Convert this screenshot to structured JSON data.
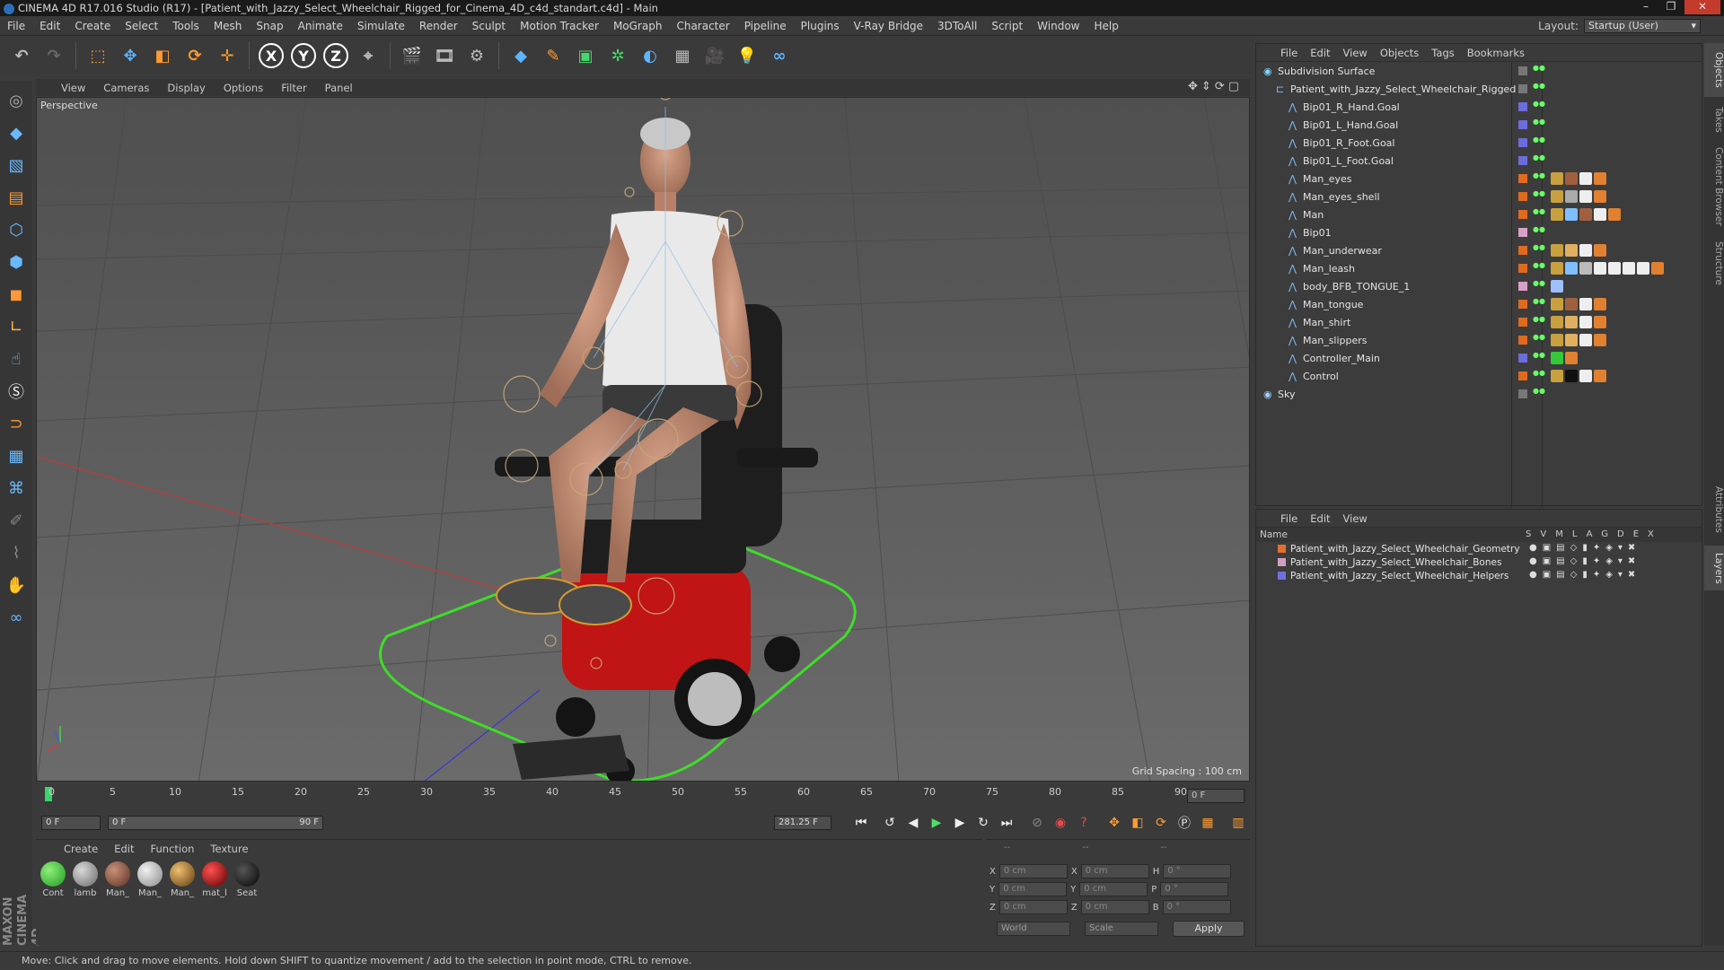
{
  "window": {
    "title": "CINEMA 4D R17.016 Studio (R17) - [Patient_with_Jazzy_Select_Wheelchair_Rigged_for_Cinema_4D_c4d_standart.c4d] - Main"
  },
  "menubar": {
    "items": [
      "File",
      "Edit",
      "Create",
      "Select",
      "Tools",
      "Mesh",
      "Snap",
      "Animate",
      "Simulate",
      "Render",
      "Sculpt",
      "Motion Tracker",
      "MoGraph",
      "Character",
      "Pipeline",
      "Plugins",
      "V-Ray Bridge",
      "3DToAll",
      "Script",
      "Window",
      "Help"
    ],
    "layout_label": "Layout:",
    "layout_value": "Startup (User)"
  },
  "viewport": {
    "menu": [
      "View",
      "Cameras",
      "Display",
      "Options",
      "Filter",
      "Panel"
    ],
    "camera": "Perspective",
    "grid_spacing": "Grid Spacing : 100 cm"
  },
  "timeline": {
    "ticks": [
      "0",
      "5",
      "10",
      "15",
      "20",
      "25",
      "30",
      "35",
      "40",
      "45",
      "50",
      "55",
      "60",
      "65",
      "70",
      "75",
      "80",
      "85",
      "90"
    ],
    "current_frame": "0 F",
    "start_field": "0 F",
    "range_start": "0 F",
    "range_end": "90 F",
    "fps_field": "281.25 F"
  },
  "materials": {
    "menu": [
      "Create",
      "Edit",
      "Function",
      "Texture"
    ],
    "items": [
      {
        "name": "Cont",
        "color": "#35c93a"
      },
      {
        "name": "lamb",
        "color": "#9a9a9a"
      },
      {
        "name": "Man_",
        "color": "#8a5a46"
      },
      {
        "name": "Man_",
        "color": "#b8b8b8"
      },
      {
        "name": "Man_",
        "color": "#c87a2a"
      },
      {
        "name": "mat_l",
        "color": "#b3141c"
      },
      {
        "name": "Seat",
        "color": "#1a1a1a"
      }
    ]
  },
  "coords": {
    "header": [
      "--",
      "--",
      "--"
    ],
    "rows": [
      {
        "a": "X",
        "av": "0 cm",
        "b": "X",
        "bv": "0 cm",
        "c": "H",
        "cv": "0 °"
      },
      {
        "a": "Y",
        "av": "0 cm",
        "b": "Y",
        "bv": "0 cm",
        "c": "P",
        "cv": "0 °"
      },
      {
        "a": "Z",
        "av": "0 cm",
        "b": "Z",
        "bv": "0 cm",
        "c": "B",
        "cv": "0 °"
      }
    ],
    "space": "World",
    "mode": "Scale",
    "apply": "Apply"
  },
  "objects": {
    "menu": [
      "File",
      "Edit",
      "View",
      "Objects",
      "Tags",
      "Bookmarks"
    ],
    "rows": [
      {
        "name": "Subdivision Surface",
        "depth": 0,
        "swatch": "#777777",
        "color": "#7fd7ff"
      },
      {
        "name": "Patient_with_Jazzy_Select_Wheelchair_Rigged",
        "depth": 1,
        "swatch": "#777777",
        "color": "#7fbfff"
      },
      {
        "name": "Bip01_R_Hand.Goal",
        "depth": 2,
        "swatch": "#6c6cdc",
        "color": "#7fbfff"
      },
      {
        "name": "Bip01_L_Hand.Goal",
        "depth": 2,
        "swatch": "#6c6cdc",
        "color": "#7fbfff"
      },
      {
        "name": "Bip01_R_Foot.Goal",
        "depth": 2,
        "swatch": "#6c6cdc",
        "color": "#7fbfff"
      },
      {
        "name": "Bip01_L_Foot.Goal",
        "depth": 2,
        "swatch": "#6c6cdc",
        "color": "#7fbfff"
      },
      {
        "name": "Man_eyes",
        "depth": 2,
        "swatch": "#e06a1e",
        "color": "#7fbfff"
      },
      {
        "name": "Man_eyes_shell",
        "depth": 2,
        "swatch": "#e06a1e",
        "color": "#7fbfff"
      },
      {
        "name": "Man",
        "depth": 2,
        "swatch": "#e06a1e",
        "color": "#7fbfff"
      },
      {
        "name": "Bip01",
        "depth": 2,
        "swatch": "#d8a0c8",
        "color": "#7fbfff"
      },
      {
        "name": "Man_underwear",
        "depth": 2,
        "swatch": "#e06a1e",
        "color": "#7fbfff"
      },
      {
        "name": "Man_leash",
        "depth": 2,
        "swatch": "#e06a1e",
        "color": "#7fbfff"
      },
      {
        "name": "body_BFB_TONGUE_1",
        "depth": 2,
        "swatch": "#d8a0c8",
        "color": "#7fbfff"
      },
      {
        "name": "Man_tongue",
        "depth": 2,
        "swatch": "#e06a1e",
        "color": "#7fbfff"
      },
      {
        "name": "Man_shirt",
        "depth": 2,
        "swatch": "#e06a1e",
        "color": "#7fbfff"
      },
      {
        "name": "Man_slippers",
        "depth": 2,
        "swatch": "#e06a1e",
        "color": "#7fbfff"
      },
      {
        "name": "Controller_Main",
        "depth": 2,
        "swatch": "#6c6cdc",
        "color": "#7fbfff"
      },
      {
        "name": "Control",
        "depth": 2,
        "swatch": "#e06a1e",
        "color": "#7fbfff"
      },
      {
        "name": "Sky",
        "depth": 0,
        "swatch": "#777777",
        "color": "#9fd0ff"
      }
    ]
  },
  "layers": {
    "menu": [
      "File",
      "Edit",
      "View"
    ],
    "header_name": "Name",
    "header_cols": "SVMLAGDEX",
    "rows": [
      {
        "name": "Patient_with_Jazzy_Select_Wheelchair_Geometry",
        "color": "#e07030"
      },
      {
        "name": "Patient_with_Jazzy_Select_Wheelchair_Bones",
        "color": "#d0a0c0"
      },
      {
        "name": "Patient_with_Jazzy_Select_Wheelchair_Helpers",
        "color": "#7070e0"
      }
    ]
  },
  "righttabs": [
    "Objects",
    "Takes",
    "Content Browser",
    "Structure",
    "Attributes",
    "Layers"
  ],
  "status": "Move: Click and drag to move elements. Hold down SHIFT to quantize movement / add to the selection in point mode, CTRL to remove.",
  "brand": "MAXON CINEMA 4D"
}
